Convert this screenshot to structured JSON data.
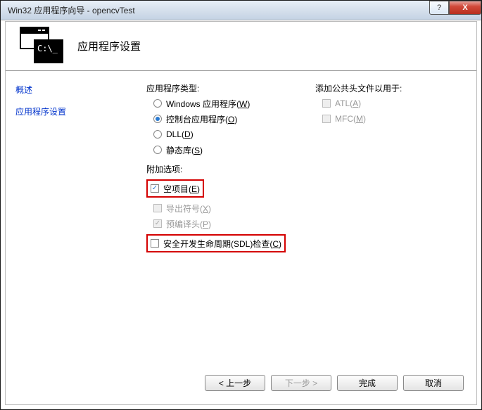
{
  "titlebar": {
    "title": "Win32 应用程序向导 - opencvTest",
    "help_label": "?",
    "close_label": "X"
  },
  "header": {
    "icon_prompt": "C:\\_",
    "title": "应用程序设置"
  },
  "sidebar": {
    "items": [
      {
        "label": "概述"
      },
      {
        "label": "应用程序设置"
      }
    ]
  },
  "app_type": {
    "label": "应用程序类型:",
    "options": [
      {
        "label": "Windows 应用程序(",
        "key": "W",
        "suffix": ")",
        "selected": false
      },
      {
        "label": "控制台应用程序(",
        "key": "O",
        "suffix": ")",
        "selected": true
      },
      {
        "label": "DLL(",
        "key": "D",
        "suffix": ")",
        "selected": false
      },
      {
        "label": "静态库(",
        "key": "S",
        "suffix": ")",
        "selected": false
      }
    ]
  },
  "additional": {
    "label": "附加选项:",
    "options": [
      {
        "label": "空项目(",
        "key": "E",
        "suffix": ")",
        "checked": true,
        "disabled": false,
        "highlight": true
      },
      {
        "label": "导出符号(",
        "key": "X",
        "suffix": ")",
        "checked": false,
        "disabled": true,
        "highlight": false
      },
      {
        "label": "预编译头(",
        "key": "P",
        "suffix": ")",
        "checked": true,
        "disabled": true,
        "highlight": false
      },
      {
        "label": "安全开发生命周期(SDL)检查(",
        "key": "C",
        "suffix": ")",
        "checked": false,
        "disabled": false,
        "highlight": true
      }
    ]
  },
  "common_headers": {
    "label": "添加公共头文件以用于:",
    "options": [
      {
        "label": "ATL(",
        "key": "A",
        "suffix": ")",
        "checked": false,
        "disabled": true
      },
      {
        "label": "MFC(",
        "key": "M",
        "suffix": ")",
        "checked": false,
        "disabled": true
      }
    ]
  },
  "footer": {
    "prev_label": "< 上一步",
    "next_label": "下一步 >",
    "finish_label": "完成",
    "cancel_label": "取消",
    "next_disabled": true
  }
}
